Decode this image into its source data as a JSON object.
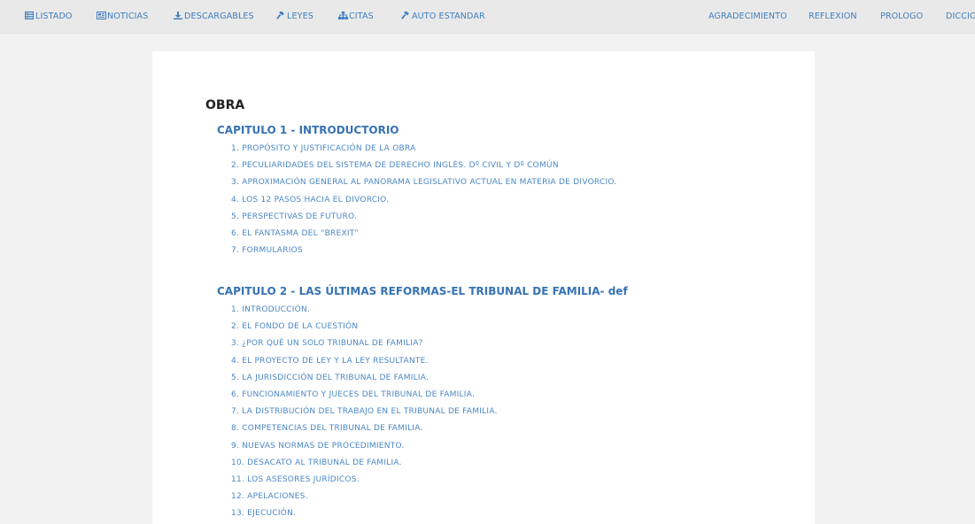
{
  "nav": {
    "left": [
      {
        "label": "LISTADO",
        "icon": "list-icon"
      },
      {
        "label": "NOTICIAS",
        "icon": "newspaper-icon"
      },
      {
        "label": "DESCARGABLES",
        "icon": "download-icon"
      },
      {
        "label": "LEYES",
        "icon": "gavel-icon"
      },
      {
        "label": "CITAS",
        "icon": "sitemap-icon"
      },
      {
        "label": "AUTO ESTANDAR",
        "icon": "gavel-icon"
      }
    ],
    "right": [
      "AGRADECIMIENTO",
      "REFLEXION",
      "PROLOGO",
      "DICCIO"
    ]
  },
  "main": {
    "title": "OBRA",
    "chapters": [
      {
        "title": "CAPITULO 1 - INTRODUCTORIO",
        "items": [
          "1. PROPÓSITO Y JUSTIFICACIÓN DE LA OBRA",
          "2. PECULIARIDADES DEL SISTEMA DE DERECHO INGLÉS. Dº CIVIL Y Dº COMÚN",
          "3. APROXIMACIÓN GENERAL AL PANORAMA LEGISLATIVO ACTUAL EN MATERIA DE DIVORCIO.",
          "4. LOS 12 PASOS HACIA EL DIVORCIO.",
          "5. PERSPECTIVAS DE FUTURO.",
          "6. EL FANTASMA DEL “BREXIT”",
          "7. FORMULARIOS"
        ]
      },
      {
        "title": "CAPITULO 2 - LAS ÚLTIMAS REFORMAS-EL TRIBUNAL DE FAMILIA- def",
        "items": [
          "1. INTRODUCCIÓN.",
          "2. EL FONDO DE LA CUESTIÓN",
          "3. ¿POR QUÉ UN SOLO TRIBUNAL DE FAMILIA?",
          "4. EL PROYECTO DE LEY Y LA LEY RESULTANTE.",
          "5. LA JURISDICCIÓN DEL TRIBUNAL DE FAMILIA.",
          "6. FUNCIONAMIENTO Y JUECES DEL TRIBUNAL DE FAMILIA.",
          "7. LA DISTRIBUCIÓN DEL TRABAJO EN EL TRIBUNAL DE FAMILIA.",
          "8. COMPETENCIAS DEL TRIBUNAL DE FAMILIA.",
          "9. NUEVAS NORMAS DE PROCEDIMIENTO.",
          "10. DESACATO AL TRIBUNAL DE FAMILIA.",
          "11. LOS ASESORES JURÍDICOS.",
          "12. APELACIONES.",
          "13. EJECUCIÓN."
        ]
      }
    ]
  },
  "colors": {
    "link": "#4a87c5",
    "chapter_title": "#3773b4",
    "nav_link": "#3f7fc1",
    "nav_bg": "#e9e9e9",
    "page_bg": "#f2f2f2"
  }
}
